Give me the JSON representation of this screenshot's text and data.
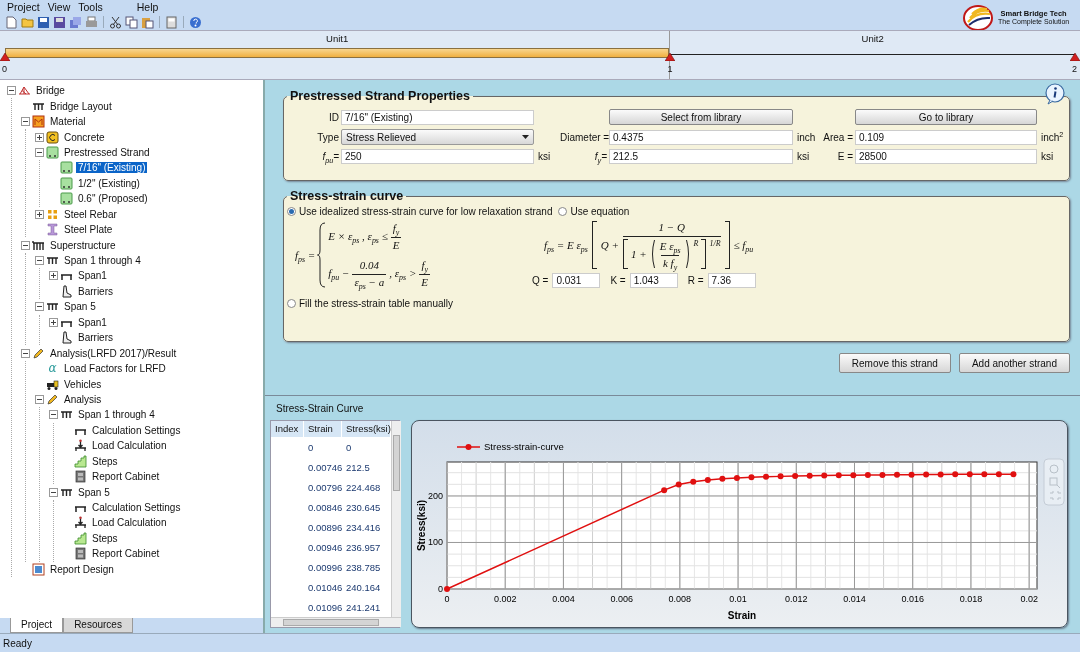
{
  "menu": [
    {
      "label": "Project"
    },
    {
      "label": "View"
    },
    {
      "label": "Tools"
    },
    {
      "label": "Help"
    }
  ],
  "logo": {
    "name": "Smart Bridge Tech",
    "tagline": "The Complete Solution"
  },
  "span_strip": {
    "units": [
      {
        "label": "Unit1",
        "selected": true
      },
      {
        "label": "Unit2",
        "selected": false
      }
    ],
    "supports": [
      "0",
      "1",
      "2"
    ]
  },
  "tree": [
    {
      "label": "Bridge",
      "kind": "bridge",
      "selected": false,
      "expanded": true,
      "children": [
        {
          "label": "Bridge Layout",
          "kind": "girder",
          "selected": false
        },
        {
          "label": "Material",
          "kind": "material",
          "selected": false,
          "expanded": true,
          "children": [
            {
              "label": "Concrete",
              "kind": "concrete",
              "selected": false,
              "expanded": false
            },
            {
              "label": "Prestressed Strand",
              "kind": "strand",
              "selected": false,
              "expanded": true,
              "children": [
                {
                  "label": "7/16\" (Existing)",
                  "kind": "strand",
                  "selected": true
                },
                {
                  "label": "1/2\" (Existing)",
                  "kind": "strand",
                  "selected": false
                },
                {
                  "label": "0.6\" (Proposed)",
                  "kind": "strand",
                  "selected": false
                }
              ]
            },
            {
              "label": "Steel Rebar",
              "kind": "rebar",
              "selected": false,
              "expanded": false
            },
            {
              "label": "Steel Plate",
              "kind": "plate",
              "selected": false
            }
          ]
        },
        {
          "label": "Superstructure",
          "kind": "superstructure",
          "selected": false,
          "expanded": true,
          "children": [
            {
              "label": "Span 1 through 4",
              "kind": "girder",
              "selected": false,
              "expanded": true,
              "children": [
                {
                  "label": "Span1",
                  "kind": "span",
                  "selected": false,
                  "expanded": false
                },
                {
                  "label": "Barriers",
                  "kind": "barrier",
                  "selected": false
                }
              ]
            },
            {
              "label": "Span 5",
              "kind": "girder",
              "selected": false,
              "expanded": true,
              "children": [
                {
                  "label": "Span1",
                  "kind": "span",
                  "selected": false,
                  "expanded": false
                },
                {
                  "label": "Barriers",
                  "kind": "barrier",
                  "selected": false
                }
              ]
            }
          ]
        },
        {
          "label": "Analysis(LRFD 2017)/Result",
          "kind": "analysis",
          "selected": false,
          "expanded": true,
          "children": [
            {
              "label": "Load Factors for LRFD",
              "kind": "glyph",
              "glyph": "α",
              "selected": false
            },
            {
              "label": "Vehicles",
              "kind": "vehicle",
              "selected": false
            },
            {
              "label": "Analysis",
              "kind": "analysis",
              "selected": false,
              "expanded": true,
              "children": [
                {
                  "label": "Span 1 through 4",
                  "kind": "girder",
                  "selected": false,
                  "expanded": true,
                  "children": [
                    {
                      "label": "Calculation Settings",
                      "kind": "span",
                      "selected": false
                    },
                    {
                      "label": "Load Calculation",
                      "kind": "load",
                      "selected": false
                    },
                    {
                      "label": "Steps",
                      "kind": "steps",
                      "selected": false
                    },
                    {
                      "label": "Report Cabinet",
                      "kind": "cabinet",
                      "selected": false
                    }
                  ]
                },
                {
                  "label": "Span 5",
                  "kind": "girder",
                  "selected": false,
                  "expanded": true,
                  "children": [
                    {
                      "label": "Calculation Settings",
                      "kind": "span",
                      "selected": false
                    },
                    {
                      "label": "Load Calculation",
                      "kind": "load",
                      "selected": false
                    },
                    {
                      "label": "Steps",
                      "kind": "steps",
                      "selected": false
                    },
                    {
                      "label": "Report Cabinet",
                      "kind": "cabinet",
                      "selected": false
                    }
                  ]
                }
              ]
            }
          ]
        },
        {
          "label": "Report Design",
          "kind": "report",
          "selected": false
        }
      ]
    }
  ],
  "panel_tabs": [
    {
      "label": "Project",
      "selected": true
    },
    {
      "label": "Resources",
      "selected": false
    }
  ],
  "properties": {
    "title": "Prestressed Strand Properties",
    "id": {
      "label": "ID",
      "value": "7/16\" (Existing)"
    },
    "type": {
      "label": "Type",
      "value": "Stress Relieved"
    },
    "fpu": {
      "label": "f$_{pu}$=",
      "value": "250",
      "unit": "ksi"
    },
    "diameter": {
      "label": "Diameter =",
      "value": "0.4375",
      "unit": "inch"
    },
    "fy": {
      "label": "f$_{y}$=",
      "value": "212.5",
      "unit": "ksi"
    },
    "area": {
      "label": "Area =",
      "value": "0.109",
      "unit": "inch$^{2}$"
    },
    "e": {
      "label": "E =",
      "value": "28500",
      "unit": "ksi"
    },
    "buttons": [
      "Select from library",
      "Go to library"
    ]
  },
  "curve_settings": {
    "title": "Stress-strain curve",
    "options": [
      {
        "label": "Use idealized stress-strain curve for low relaxation strand",
        "selected": true
      },
      {
        "label": "Use equation",
        "selected": false
      },
      {
        "label": "Fill the stress-strain table manually",
        "selected": false
      }
    ],
    "idealized_formula": {
      "lhs": "f$_{ps}$ =",
      "cases": [
        [
          {
            "kind": "text",
            "text": "E × ε$_{ps}$ ,  ε$_{ps}$ ≤"
          },
          {
            "kind": "frac",
            "num": "f$_{y}$",
            "den": "E"
          }
        ],
        [
          {
            "kind": "text",
            "text": "f$_{pu}$ −"
          },
          {
            "kind": "frac",
            "num": "0.04",
            "den": "ε$_{ps}$ − a"
          },
          {
            "kind": "text",
            "text": ",  ε$_{ps}$ >"
          },
          {
            "kind": "frac",
            "num": "f$_{y}$",
            "den": "E"
          }
        ]
      ]
    },
    "equation": {
      "lhs": "f$_{ps}$ =  E  ε$_{ps}$",
      "q_term": "Q +",
      "numerator": "1 − Q",
      "den_lead": "1 +",
      "inner_num": "E ε$_{ps}$",
      "inner_den": "k f$_{y}$",
      "exp_inner": "R",
      "exp_outer": "1/R",
      "rhs": "≤ f$_{pu}$"
    },
    "coefficients": [
      {
        "label": "Q =",
        "value": "0.031"
      },
      {
        "label": "K =",
        "value": "1.043"
      },
      {
        "label": "R =",
        "value": "7.36"
      }
    ]
  },
  "actions": [
    "Remove this strand",
    "Add another strand"
  ],
  "curve_section": {
    "title": "Stress-Strain Curve",
    "table": {
      "columns": [
        "Index",
        "Strain",
        "Stress(ksi)"
      ],
      "rows": [
        {
          "strain": "0",
          "stress": "0"
        },
        {
          "strain": "0.00746",
          "stress": "212.5"
        },
        {
          "strain": "0.00796",
          "stress": "224.468"
        },
        {
          "strain": "0.00846",
          "stress": "230.645"
        },
        {
          "strain": "0.00896",
          "stress": "234.416"
        },
        {
          "strain": "0.00946",
          "stress": "236.957"
        },
        {
          "strain": "0.00996",
          "stress": "238.785"
        },
        {
          "strain": "0.01046",
          "stress": "240.164"
        },
        {
          "strain": "0.01096",
          "stress": "241.241"
        }
      ]
    },
    "chart_data": {
      "type": "line",
      "grid": true,
      "xlabel": "Strain",
      "ylabel": "Stress(ksi)",
      "xlim": [
        0,
        0.02027
      ],
      "ylim": [
        0,
        273
      ],
      "xticks": [
        0,
        0.002,
        0.004,
        0.006,
        0.008,
        0.01,
        0.012,
        0.014,
        0.016,
        0.018,
        0.02
      ],
      "yticks": [
        0,
        100,
        200
      ],
      "x": [
        0,
        0.00746,
        0.00796,
        0.00846,
        0.00896,
        0.00946,
        0.00996,
        0.01046,
        0.01096,
        0.01146,
        0.01196,
        0.01246,
        0.01296,
        0.01346,
        0.01396,
        0.01446,
        0.01496,
        0.01546,
        0.01596,
        0.01646,
        0.01696,
        0.01746,
        0.01796,
        0.01846,
        0.01896,
        0.01946
      ],
      "series": [
        {
          "name": "Stress-strain-curve",
          "color": "#e01010",
          "marker": "circle",
          "values": [
            0,
            212.5,
            224.5,
            230.6,
            234.4,
            237,
            238.8,
            240.2,
            241.2,
            242.1,
            242.8,
            243.4,
            243.9,
            244.3,
            244.7,
            245,
            245.3,
            245.6,
            245.8,
            246,
            246.2,
            246.4,
            246.5,
            246.7,
            246.8,
            246.9
          ]
        }
      ]
    }
  },
  "status_bar": "Ready"
}
